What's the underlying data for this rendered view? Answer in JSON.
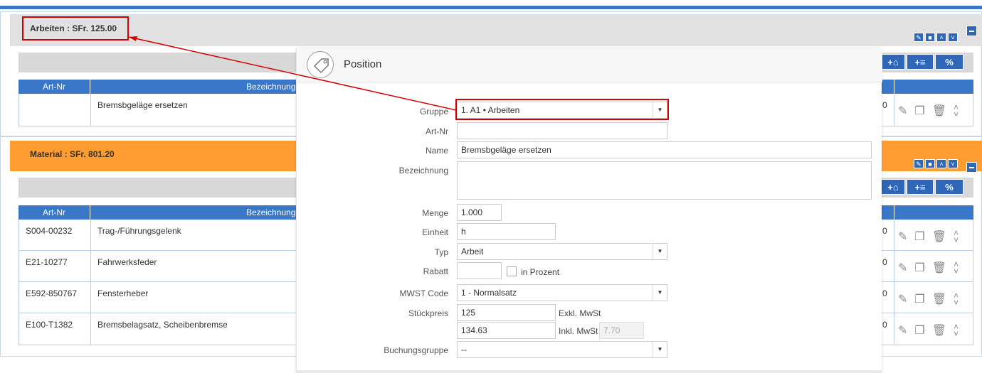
{
  "arbeiten": {
    "title": "Arbeiten : SFr. 125.00"
  },
  "material": {
    "title": "Material : SFr. 801.20"
  },
  "table": {
    "col_artnr": "Art-Nr",
    "col_bezeichnung": "Bezeichnung",
    "cut_value": "0"
  },
  "arbeiten_rows": [
    {
      "artnr": "",
      "bezeichnung": "Bremsbgeläge ersetzen"
    }
  ],
  "material_rows": [
    {
      "artnr": "S004-00232",
      "bezeichnung": "Trag-/Führungsgelenk"
    },
    {
      "artnr": "E21-10277",
      "bezeichnung": "Fahrwerksfeder"
    },
    {
      "artnr": "E592-850767",
      "bezeichnung": "Fensterheber"
    },
    {
      "artnr": "E100-T1382",
      "bezeichnung": "Bremsbelagsatz, Scheibenbremse"
    }
  ],
  "buttons": {
    "percent": "%",
    "add_list": "+≡",
    "tag": "+⌂"
  },
  "modal": {
    "title": "Position",
    "labels": {
      "gruppe": "Gruppe",
      "artnr": "Art-Nr",
      "name": "Name",
      "bezeichnung": "Bezeichnung",
      "menge": "Menge",
      "einheit": "Einheit",
      "typ": "Typ",
      "rabatt": "Rabatt",
      "in_prozent": "in Prozent",
      "mwst_code": "MWST Code",
      "stueckpreis": "Stückpreis",
      "exkl": "Exkl. MwSt",
      "inkl": "Inkl. MwSt",
      "buchungsgruppe": "Buchungsgruppe"
    },
    "values": {
      "gruppe": "1. A1 • Arbeiten",
      "artnr": "",
      "name": "Bremsbgeläge ersetzen",
      "bezeichnung": "",
      "menge": "1.000",
      "einheit": "h",
      "typ": "Arbeit",
      "rabatt": "",
      "mwst_code": "1 - Normalsatz",
      "preis_exkl": "125",
      "preis_inkl": "134.63",
      "mwst_rate": "7.70",
      "buchungsgruppe": "--"
    }
  },
  "colors": {
    "accent": "#3a77c8",
    "orange": "#ff9d33",
    "highlight": "#d40000"
  }
}
